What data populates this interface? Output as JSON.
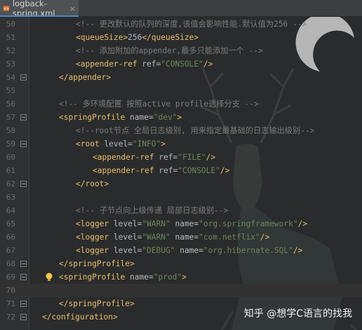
{
  "tab": {
    "title": "logback-spring.xml",
    "close": "×"
  },
  "lines": [
    {
      "n": "50",
      "indent": 4,
      "tokens": [
        [
          "c",
          "<!-- 更改默认的队列的深度,该值会影响性能.默认值为256 -->"
        ]
      ]
    },
    {
      "n": "51",
      "indent": 4,
      "tokens": [
        [
          "b",
          "<queueSize>"
        ],
        [
          "t",
          "256"
        ],
        [
          "b",
          "</queueSize>"
        ]
      ]
    },
    {
      "n": "52",
      "indent": 4,
      "tokens": [
        [
          "c",
          "<!-- 添加附加的appender,最多只能添加一个 -->"
        ]
      ]
    },
    {
      "n": "53",
      "indent": 4,
      "tokens": [
        [
          "b",
          "<appender-ref "
        ],
        [
          "a",
          "ref="
        ],
        [
          "v",
          "\"CONSOLE\""
        ],
        [
          "b",
          "/>"
        ]
      ]
    },
    {
      "n": "54",
      "indent": 2,
      "tokens": [
        [
          "b",
          "</appender>"
        ]
      ]
    },
    {
      "n": "55",
      "indent": 0,
      "tokens": []
    },
    {
      "n": "56",
      "indent": 2,
      "tokens": [
        [
          "c",
          "<!-- 多环境配置 按照active profile选择分支 -->"
        ]
      ]
    },
    {
      "n": "57",
      "indent": 2,
      "tokens": [
        [
          "b",
          "<springProfile "
        ],
        [
          "a",
          "name="
        ],
        [
          "v",
          "\"dev\""
        ],
        [
          "b",
          ">"
        ]
      ]
    },
    {
      "n": "58",
      "indent": 4,
      "tokens": [
        [
          "c",
          "<!--root节点 全局日志级别, 用来指定最基础的日志输出级别-->"
        ]
      ]
    },
    {
      "n": "59",
      "indent": 4,
      "tokens": [
        [
          "b",
          "<root "
        ],
        [
          "a",
          "level="
        ],
        [
          "v",
          "\"INFO\""
        ],
        [
          "b",
          ">"
        ]
      ]
    },
    {
      "n": "60",
      "indent": 6,
      "tokens": [
        [
          "b",
          "<appender-ref "
        ],
        [
          "a",
          "ref="
        ],
        [
          "v",
          "\"FILE\""
        ],
        [
          "b",
          "/>"
        ]
      ]
    },
    {
      "n": "61",
      "indent": 6,
      "tokens": [
        [
          "b",
          "<appender-ref "
        ],
        [
          "a",
          "ref="
        ],
        [
          "v",
          "\"CONSOLE\""
        ],
        [
          "b",
          "/>"
        ]
      ]
    },
    {
      "n": "62",
      "indent": 4,
      "tokens": [
        [
          "b",
          "</root>"
        ]
      ]
    },
    {
      "n": "63",
      "indent": 0,
      "tokens": []
    },
    {
      "n": "64",
      "indent": 4,
      "tokens": [
        [
          "c",
          "<!-- 子节点向上级传递 局部日志级别-->"
        ]
      ]
    },
    {
      "n": "65",
      "indent": 4,
      "tokens": [
        [
          "b",
          "<logger "
        ],
        [
          "a",
          "level="
        ],
        [
          "v",
          "\"WARN\""
        ],
        [
          "a",
          " name="
        ],
        [
          "v",
          "\"org.springframework\""
        ],
        [
          "b",
          "/>"
        ]
      ]
    },
    {
      "n": "66",
      "indent": 4,
      "tokens": [
        [
          "b",
          "<logger "
        ],
        [
          "a",
          "level="
        ],
        [
          "v",
          "\"WARN\""
        ],
        [
          "a",
          " name="
        ],
        [
          "v",
          "\"com.netflix\""
        ],
        [
          "b",
          "/>"
        ]
      ]
    },
    {
      "n": "67",
      "indent": 4,
      "tokens": [
        [
          "b",
          "<logger "
        ],
        [
          "a",
          "level="
        ],
        [
          "v",
          "\"DEBUG\""
        ],
        [
          "a",
          " name="
        ],
        [
          "v",
          "\"org.hibernate.SQL\""
        ],
        [
          "b",
          "/>"
        ]
      ]
    },
    {
      "n": "68",
      "indent": 2,
      "tokens": [
        [
          "b",
          "</springProfile>"
        ]
      ]
    },
    {
      "n": "69",
      "indent": 2,
      "tokens": [
        [
          "b",
          "<springProfile "
        ],
        [
          "a",
          "name="
        ],
        [
          "v",
          "\"prod\""
        ],
        [
          "b",
          ">"
        ]
      ]
    },
    {
      "n": "70",
      "indent": 0,
      "tokens": [],
      "current": true
    },
    {
      "n": "71",
      "indent": 2,
      "tokens": [
        [
          "b",
          "</springProfile>"
        ]
      ]
    },
    {
      "n": "72",
      "indent": 0,
      "tokens": [
        [
          "b",
          "</configuration>"
        ]
      ]
    }
  ],
  "folds": {
    "open": [
      "57",
      "59",
      "69"
    ],
    "close": [
      "54",
      "62",
      "68",
      "71",
      "72"
    ]
  },
  "intention_bulb_line": "69",
  "watermark": "知乎 @想学C语言的找我",
  "colors": {
    "tag": "#e8bf6a",
    "attr": "#bababa",
    "value": "#6a8759",
    "comment": "#7c7c7c",
    "text": "#a9b7c6",
    "background": "#2b2b2b"
  }
}
